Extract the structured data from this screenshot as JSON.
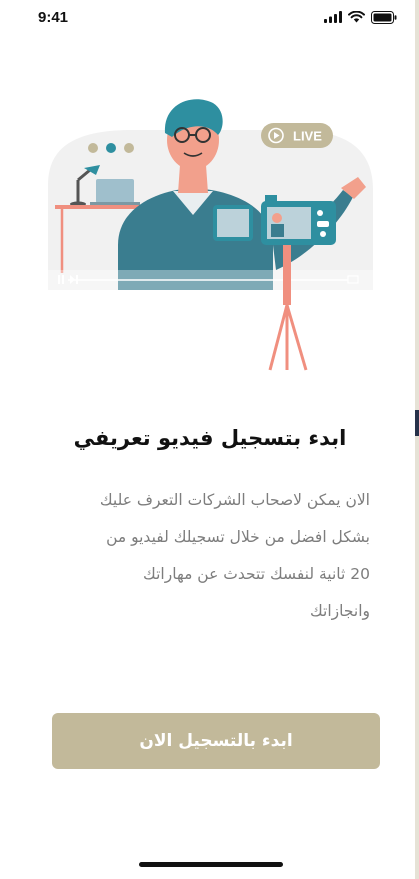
{
  "status_bar": {
    "time": "9:41"
  },
  "hero": {
    "live_label": "LIVE"
  },
  "content": {
    "title": "ابدء بتسجيل فيديو تعريفي",
    "description_lines": [
      "الان يمكن لاصحاب الشركات التعرف عليك",
      "بشكل افضل من خلال تسجيلك لفيديو من",
      "20 ثانية لنفسك  تتحدث عن مهاراتك",
      "وانجازاتك"
    ]
  },
  "cta": {
    "label": "ابدء بالتسجيل الان"
  },
  "colors": {
    "accent": "#c2b99a",
    "teal": "#2e8fa0",
    "coral": "#f08f7f",
    "body_text": "#7d7d7d"
  }
}
